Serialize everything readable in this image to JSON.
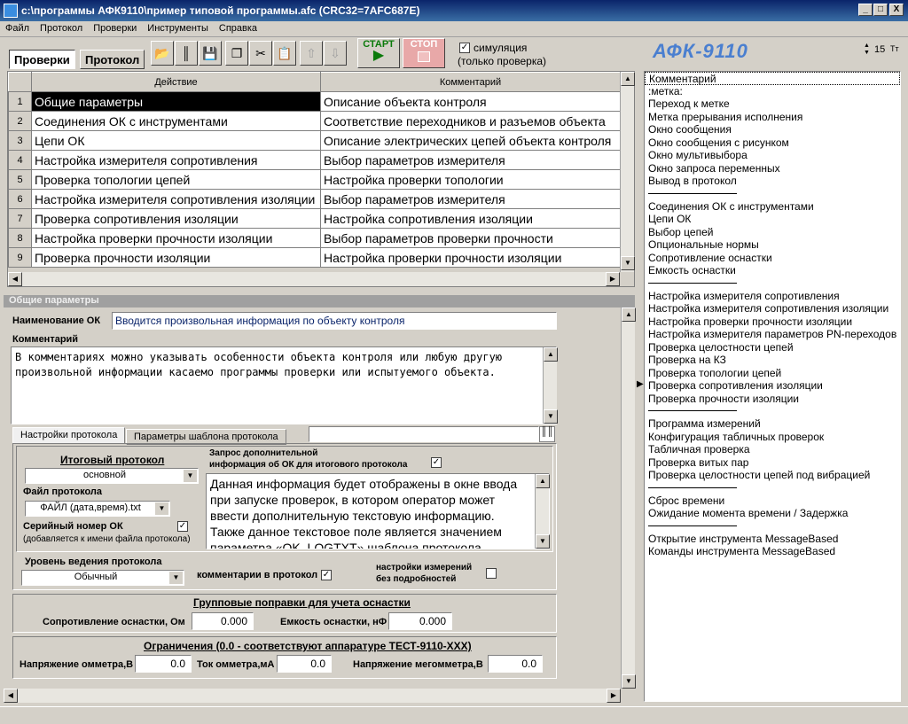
{
  "window": {
    "title": "c:\\программы АФК9110\\пример типовой программы.afc (CRC32=7AFC687E)",
    "min": "_",
    "max": "□",
    "close": "X"
  },
  "menu": [
    "Файл",
    "Протокол",
    "Проверки",
    "Инструменты",
    "Справка"
  ],
  "tabs": {
    "checks": "Проверки",
    "protocol": "Протокол"
  },
  "toolbar": {
    "start": "СТАРТ",
    "stop": "СТОП",
    "simulation": "симуляция",
    "simulation_note": "(только проверка)",
    "brand": "АФК-9110",
    "font_size": "15"
  },
  "grid": {
    "col_action": "Действие",
    "col_comment": "Комментарий",
    "rows": [
      {
        "n": "1",
        "action": "Общие параметры",
        "comment": "Описание объекта контроля"
      },
      {
        "n": "2",
        "action": "Соединения ОК с инструментами",
        "comment": "Соответствие переходников и разъемов объекта"
      },
      {
        "n": "3",
        "action": "Цепи ОК",
        "comment": "Описание электрических цепей объекта контроля"
      },
      {
        "n": "4",
        "action": "Настройка измерителя сопротивления",
        "comment": "Выбор параметров измерителя"
      },
      {
        "n": "5",
        "action": "Проверка топологии цепей",
        "comment": "Настройка проверки топологии"
      },
      {
        "n": "6",
        "action": "Настройка измерителя сопротивления изоляции",
        "comment": "Выбор параметров измерителя"
      },
      {
        "n": "7",
        "action": "Проверка сопротивления изоляции",
        "comment": "Настройка сопротивления изоляции"
      },
      {
        "n": "8",
        "action": "Настройка проверки прочности изоляции",
        "comment": "Выбор параметров проверки прочности"
      },
      {
        "n": "9",
        "action": "Проверка прочности изоляции",
        "comment": "Настройка проверки прочности изоляции"
      }
    ]
  },
  "params": {
    "header": "Общие параметры",
    "name_label": "Наименование ОК",
    "name_value": "Вводится произвольная информация по объекту контроля",
    "comment_label": "Комментарий",
    "comment_text": "В комментариях можно указывать особенности объекта контроля или любую другую произвольной информации касаемо программы проверки или испытуемого объекта.",
    "tab_protocol_settings": "Настройки протокола",
    "tab_template_params": "Параметры шаблона протокола",
    "final_protocol_label": "Итоговый протокол",
    "final_protocol_value": "основной",
    "protocol_file_label": "Файл протокола",
    "protocol_file_value": "ФАЙЛ (дата,время).txt",
    "serial_label": "Серийный номер ОК",
    "serial_note": "(добавляется к имени файла протокола)",
    "extra_info_label_1": "Запрос дополнительной",
    "extra_info_label_2": "информация об ОК для итогового протокола",
    "info_text": "Данная информация будет отображены в окне ввода при запуске проверок, в котором оператор может ввести дополнительную текстовую информацию. Также данное текстовое поле является значением параметра «OK_LOGTXT» шаблона протокола.",
    "log_level_label": "Уровень ведения протокола",
    "log_level_value": "Обычный",
    "comments_in_protocol": "комментарии в протокол",
    "meas_settings_1": "настройки измерений",
    "meas_settings_2": "без подробностей",
    "group_corr_title": "Групповые поправки для учета оснастки",
    "fixture_res_label": "Сопротивление оснастки, Ом",
    "fixture_res_value": "0.000",
    "fixture_cap_label": "Емкость оснастки, нФ",
    "fixture_cap_value": "0.000",
    "limits_title": "Ограничения (0.0 - соответствуют аппаратуре ТЕСТ-9110-XXX)",
    "ohm_voltage_label": "Напряжение омметра,В",
    "ohm_voltage_value": "0.0",
    "ohm_current_label": "Ток омметра,мА",
    "ohm_current_value": "0.0",
    "megohm_voltage_label": "Напряжение мегомметра,В",
    "megohm_voltage_value": "0.0"
  },
  "right_list": {
    "groups": [
      [
        "Комментарий",
        ":метка:",
        "Переход к метке",
        "Метка прерывания исполнения",
        "Окно сообщения",
        "Окно сообщения с рисунком",
        "Окно мультивыбора",
        "Окно запроса переменных",
        "Вывод в протокол"
      ],
      [
        "Соединения ОК с инструментами",
        "Цепи ОК",
        "Выбор цепей",
        "Опциональные нормы",
        "Сопротивление оснастки",
        "Емкость оснастки"
      ],
      [
        "Настройка измерителя сопротивления",
        "Настройка измерителя сопротивления изоляции",
        "Настройка проверки прочности изоляции",
        "Настройка измерителя параметров PN-переходов",
        "Проверка целостности цепей",
        "Проверка на КЗ",
        "Проверка топологии цепей",
        "Проверка сопротивления изоляции",
        "Проверка прочности изоляции"
      ],
      [
        "Программа измерений",
        "Конфигурация табличных проверок",
        "Табличная проверка",
        "Проверка витых пар",
        "Проверка целостности цепей под вибрацией"
      ],
      [
        "Сброс времени",
        "Ожидание момента времени / Задержка"
      ],
      [
        "Открытие инструмента MessageBased",
        "Команды инструмента MessageBased"
      ]
    ]
  },
  "colors": {
    "title_bar": "#0a246a",
    "brand": "#4a7fd0",
    "start": "#0a7a0a",
    "stop": "#e8a8a8"
  }
}
